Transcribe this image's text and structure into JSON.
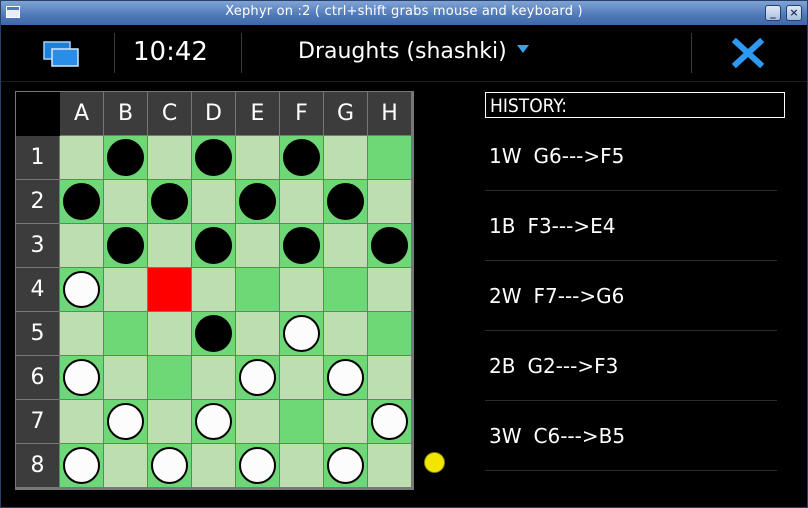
{
  "window": {
    "title": "Xephyr on :2 ( ctrl+shift grabs mouse and keyboard )"
  },
  "appbar": {
    "clock": "10:42",
    "title": "Draughts (shashki)",
    "accent_color": "#3aa0ea"
  },
  "board": {
    "columns": [
      "A",
      "B",
      "C",
      "D",
      "E",
      "F",
      "G",
      "H"
    ],
    "rows": [
      "1",
      "2",
      "3",
      "4",
      "5",
      "6",
      "7",
      "8"
    ],
    "colors": {
      "light": "#bcdeb0",
      "dark": "#6ed876",
      "selected": "#ff0000",
      "header": "#3c3c3c"
    },
    "selected_square": "C4",
    "pieces": {
      "black": [
        "B1",
        "D1",
        "F1",
        "A2",
        "C2",
        "E2",
        "G2",
        "B3",
        "D3",
        "F3",
        "H3",
        "D5"
      ],
      "white": [
        "A4",
        "F5",
        "A6",
        "E6",
        "G6",
        "B7",
        "D7",
        "H7",
        "A8",
        "C8",
        "E8",
        "G8"
      ]
    },
    "turn_indicator_color": "#f2e600"
  },
  "history": {
    "header": "HISTORY:",
    "moves": [
      {
        "num": "1W",
        "move": "G6--->F5"
      },
      {
        "num": "1B",
        "move": "F3--->E4"
      },
      {
        "num": "2W",
        "move": "F7--->G6"
      },
      {
        "num": "2B",
        "move": "G2--->F3"
      },
      {
        "num": "3W",
        "move": "C6--->B5"
      }
    ]
  }
}
